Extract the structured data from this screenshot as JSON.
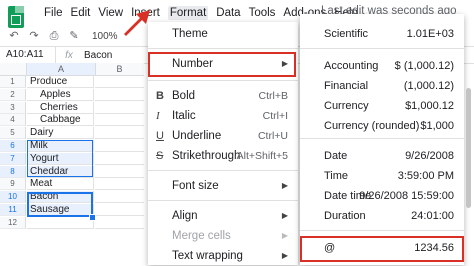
{
  "menubar": {
    "items": [
      "File",
      "Edit",
      "View",
      "Insert",
      "Format",
      "Data",
      "Tools",
      "Add-ons",
      "Help"
    ],
    "active": "Format",
    "last_edit": "Last edit was seconds ago"
  },
  "toolbar": {
    "zoom": "100%"
  },
  "formula_bar": {
    "name_box": "A10:A11",
    "fx": "fx",
    "value": "Bacon"
  },
  "grid": {
    "columns": [
      "A",
      "B"
    ],
    "rows": [
      {
        "n": "1",
        "a": "Produce",
        "indent": false,
        "sel": false
      },
      {
        "n": "2",
        "a": "Apples",
        "indent": true,
        "sel": false
      },
      {
        "n": "3",
        "a": "Cherries",
        "indent": true,
        "sel": false
      },
      {
        "n": "4",
        "a": "Cabbage",
        "indent": true,
        "sel": false
      },
      {
        "n": "5",
        "a": "Dairy",
        "indent": false,
        "sel": false
      },
      {
        "n": "6",
        "a": "Milk",
        "indent": false,
        "sel": true
      },
      {
        "n": "7",
        "a": "Yogurt",
        "indent": false,
        "sel": true
      },
      {
        "n": "8",
        "a": "Cheddar",
        "indent": false,
        "sel": true
      },
      {
        "n": "9",
        "a": "Meat",
        "indent": false,
        "sel": false
      },
      {
        "n": "10",
        "a": "Bacon",
        "indent": false,
        "sel": true
      },
      {
        "n": "11",
        "a": "Sausage",
        "indent": false,
        "sel": true
      },
      {
        "n": "12",
        "a": "",
        "indent": false,
        "sel": false
      }
    ]
  },
  "format_menu": {
    "theme": "Theme",
    "number": "Number",
    "bold": "Bold",
    "bold_short": "Ctrl+B",
    "italic": "Italic",
    "italic_short": "Ctrl+I",
    "underline": "Underline",
    "underline_short": "Ctrl+U",
    "strike": "Strikethrough",
    "strike_short": "Alt+Shift+5",
    "font_size": "Font size",
    "align": "Align",
    "merge": "Merge cells",
    "wrap": "Text wrapping"
  },
  "number_menu": [
    {
      "label": "Scientific",
      "value": "1.01E+03"
    },
    {
      "label": "Accounting",
      "value": "$ (1,000.12)"
    },
    {
      "label": "Financial",
      "value": "(1,000.12)"
    },
    {
      "label": "Currency",
      "value": "$1,000.12"
    },
    {
      "label": "Currency (rounded)",
      "value": "$1,000"
    },
    {
      "label": "Date",
      "value": "9/26/2008"
    },
    {
      "label": "Time",
      "value": "3:59:00 PM"
    },
    {
      "label": "Date time",
      "value": "9/26/2008 15:59:00"
    },
    {
      "label": "Duration",
      "value": "24:01:00"
    },
    {
      "label": "@",
      "value": "1234.56"
    }
  ],
  "colors": {
    "highlight_red": "#d93025",
    "selection_blue": "#1a73e8",
    "sheets_green": "#0f9d58"
  }
}
